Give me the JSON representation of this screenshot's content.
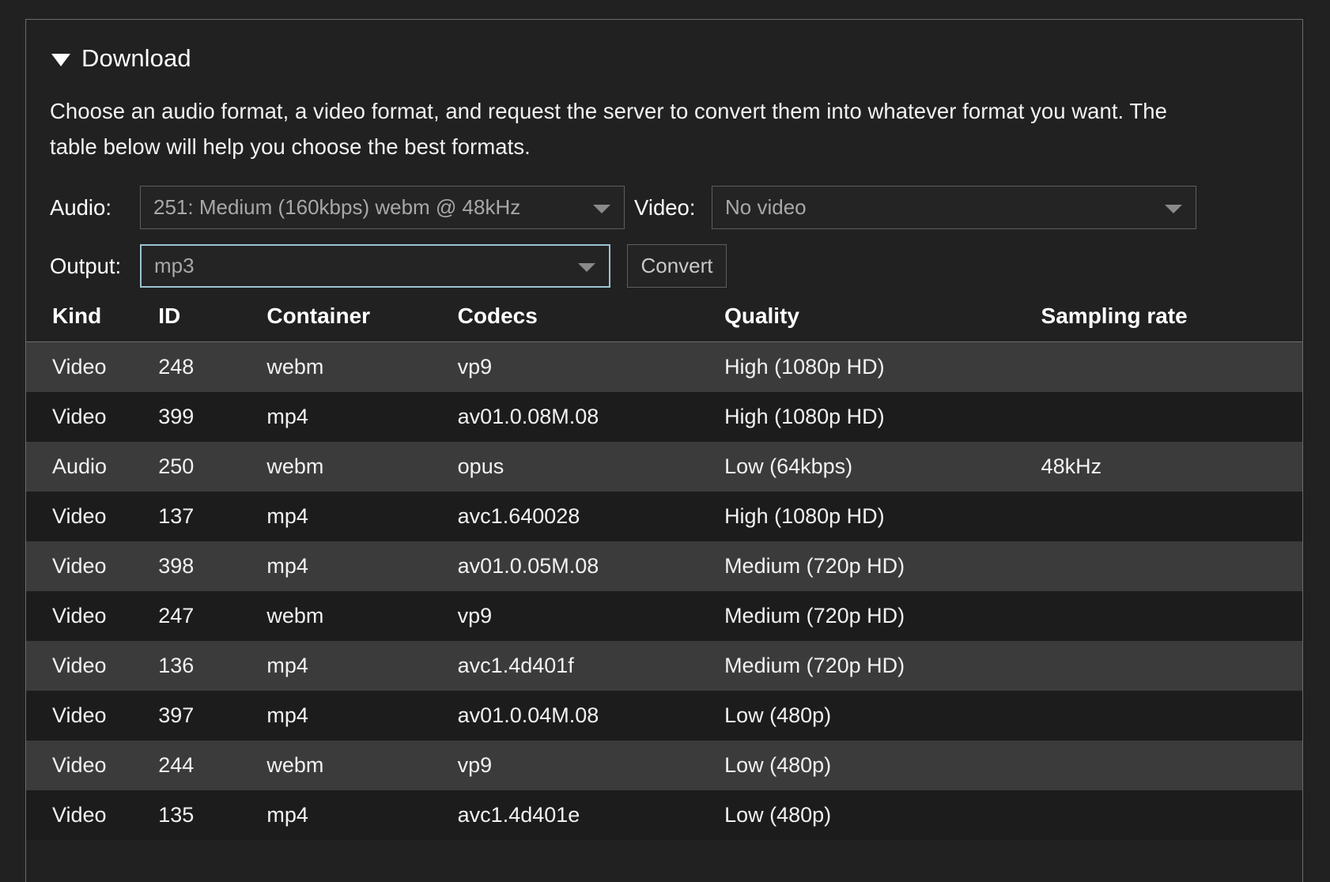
{
  "panel": {
    "section": {
      "title": "Download",
      "disclosure_icon": "triangle-down-icon",
      "expanded": true
    },
    "description": "Choose an audio format, a video format, and request the server to convert them into whatever format you want. The table below will help you choose the best formats.",
    "form": {
      "audio": {
        "label": "Audio:",
        "value": "251: Medium (160kbps) webm @ 48kHz",
        "caret_icon": "chevron-down-icon"
      },
      "video": {
        "label": "Video:",
        "value": "No video",
        "caret_icon": "chevron-down-icon"
      },
      "output": {
        "label": "Output:",
        "value": "mp3",
        "caret_icon": "chevron-down-icon",
        "focused": true,
        "focus_color": "#9cc3d4"
      },
      "convert_button": "Convert"
    },
    "table": {
      "columns": [
        "Kind",
        "ID",
        "Container",
        "Codecs",
        "Quality",
        "Sampling rate"
      ],
      "rows": [
        {
          "kind": "Video",
          "id": "248",
          "container": "webm",
          "codecs": "vp9",
          "quality": "High (1080p HD)",
          "rate": ""
        },
        {
          "kind": "Video",
          "id": "399",
          "container": "mp4",
          "codecs": "av01.0.08M.08",
          "quality": "High (1080p HD)",
          "rate": ""
        },
        {
          "kind": "Audio",
          "id": "250",
          "container": "webm",
          "codecs": "opus",
          "quality": "Low (64kbps)",
          "rate": "48kHz"
        },
        {
          "kind": "Video",
          "id": "137",
          "container": "mp4",
          "codecs": "avc1.640028",
          "quality": "High (1080p HD)",
          "rate": ""
        },
        {
          "kind": "Video",
          "id": "398",
          "container": "mp4",
          "codecs": "av01.0.05M.08",
          "quality": "Medium (720p HD)",
          "rate": ""
        },
        {
          "kind": "Video",
          "id": "247",
          "container": "webm",
          "codecs": "vp9",
          "quality": "Medium (720p HD)",
          "rate": ""
        },
        {
          "kind": "Video",
          "id": "136",
          "container": "mp4",
          "codecs": "avc1.4d401f",
          "quality": "Medium (720p HD)",
          "rate": ""
        },
        {
          "kind": "Video",
          "id": "397",
          "container": "mp4",
          "codecs": "av01.0.04M.08",
          "quality": "Low (480p)",
          "rate": ""
        },
        {
          "kind": "Video",
          "id": "244",
          "container": "webm",
          "codecs": "vp9",
          "quality": "Low (480p)",
          "rate": ""
        },
        {
          "kind": "Video",
          "id": "135",
          "container": "mp4",
          "codecs": "avc1.4d401e",
          "quality": "Low (480p)",
          "rate": ""
        }
      ]
    }
  },
  "colors": {
    "page_background": "#212121",
    "panel_border": "#6b6b6b",
    "row_light": "#3b3b3b",
    "row_dark": "#1c1c1c",
    "text_primary": "#f2f2f2",
    "text_muted": "#a8a8a8",
    "focus_border": "#9cc3d4"
  }
}
